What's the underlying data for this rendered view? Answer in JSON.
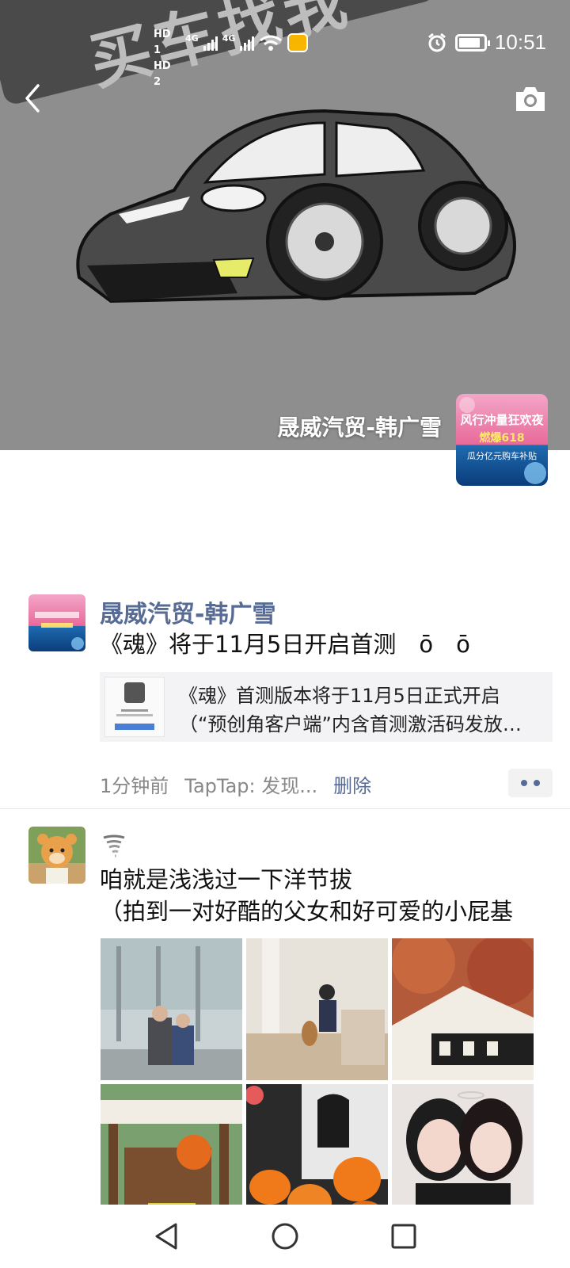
{
  "status_bar": {
    "time": "10:51",
    "network_left": "HD 1",
    "network_right": "HD 2",
    "net_type": "4G",
    "net_type2": "4G"
  },
  "cover": {
    "banner_text": "买车找我",
    "owner_name": "晟威汽贸-韩广雪",
    "avatar_caption": "风行冲量狂欢夜",
    "avatar_badge": "燃爆618",
    "avatar_sub": "瓜分亿元购车补贴"
  },
  "posts": [
    {
      "author": "晟威汽贸-韩广雪",
      "text": "《魂》将于11月5日开启首测　ō　ō",
      "share_line1": "《魂》首测版本将于11月5日正式开启",
      "share_line2": "（“预创角客户端”内含首测激活码发放…",
      "time": "1分钟前",
      "source": "TapTap: 发现...",
      "delete_label": "删除"
    },
    {
      "author_icon": "tornado-icon",
      "text_line1": "咱就是浅浅过一下洋节拔",
      "text_line2": "（拍到一对好酷的父女和好可爱的小屁基"
    }
  ],
  "colors": {
    "link_blue": "#576b95",
    "cover_gray": "#8e8e8e"
  }
}
